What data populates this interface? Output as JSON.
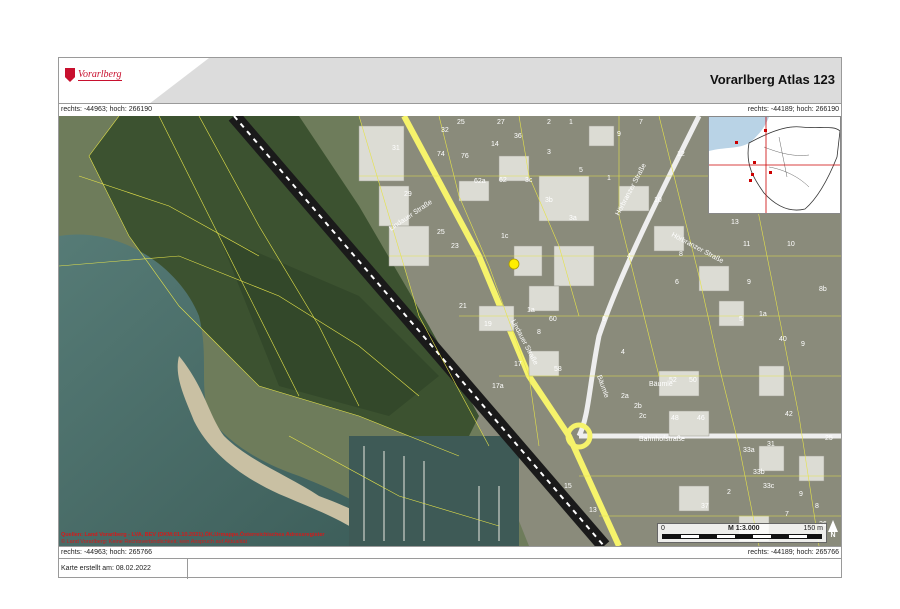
{
  "header": {
    "logo_text": "Vorarlberg",
    "title": "Vorarlberg Atlas 123",
    "brand_color": "#c8102e"
  },
  "coords": {
    "top_left": "rechts: -44963; hoch: 266190",
    "top_right": "rechts: -44189; hoch: 266190",
    "bottom_left": "rechts: -44963; hoch: 265766",
    "bottom_right": "rechts: -44189; hoch: 265766"
  },
  "map": {
    "sources": "Quellen: Land Vorarlberg - LVA, BEV (DKM:01.10.2021),ÖK,Urmappe,Österreichisches Adressregister",
    "disclaimer": "© Land Vorarlberg: Keine Rechtsverbindlichkeit, kein Anspruch auf Aktualität",
    "scale_start": "0",
    "scale_label": "M 1:3.000",
    "scale_end": "150 m",
    "north_label": "N",
    "street_labels": [
      "Lindauer Straße",
      "Lindauer Straße",
      "Hörbranzer Straße",
      "Hörbranzer Straße",
      "Bäumle",
      "Bäumle",
      "Bahnhofstraße"
    ],
    "parcel_labels": [
      "32",
      "25",
      "27",
      "2",
      "1",
      "9",
      "7",
      "31",
      "74",
      "76",
      "14",
      "36",
      "3",
      "12",
      "29",
      "62a",
      "62",
      "3c",
      "5",
      "1",
      "3b",
      "3a",
      "10",
      "25",
      "1c",
      "13",
      "23",
      "4",
      "11",
      "10",
      "8",
      "6",
      "1a",
      "9",
      "8b",
      "21",
      "6",
      "5",
      "19",
      "60",
      "8",
      "1a",
      "9",
      "17",
      "58",
      "4",
      "40",
      "17a",
      "52",
      "50",
      "2a",
      "2b",
      "2c",
      "48",
      "46",
      "42",
      "25",
      "33a",
      "33b",
      "31",
      "33c",
      "15",
      "37",
      "8",
      "7",
      "9",
      "2",
      "26",
      "13"
    ],
    "colors": {
      "parcel_line": "#e5e34a",
      "road": "#f6f36b",
      "rail": "#1a1a1a",
      "address_point": "#ffee00",
      "overview_marker": "#cc0000"
    }
  },
  "footer": {
    "created": "Karte erstellt am: 08.02.2022"
  }
}
